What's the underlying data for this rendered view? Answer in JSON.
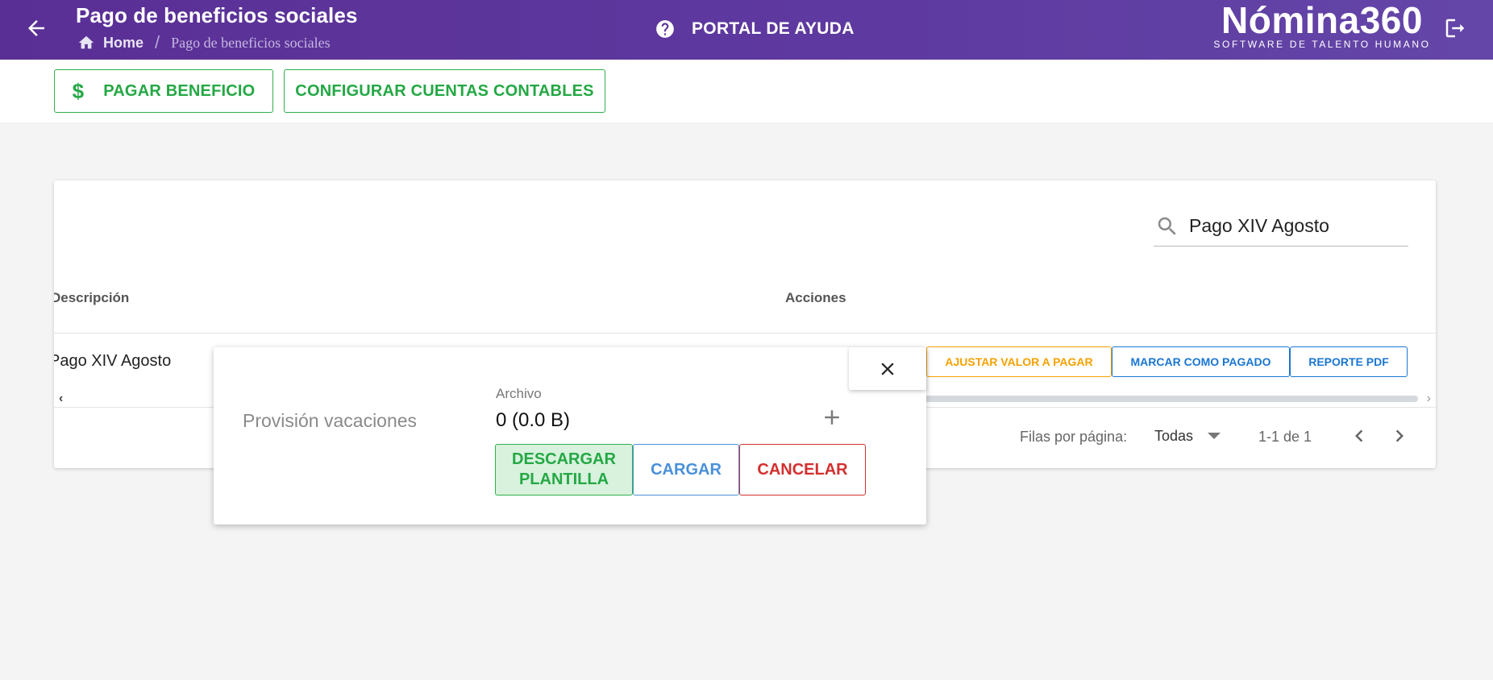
{
  "header": {
    "title": "Pago de beneficios sociales",
    "breadcrumb": {
      "home": "Home",
      "separator": "/",
      "current": "Pago de beneficios sociales"
    },
    "help_label": "PORTAL DE AYUDA",
    "brand_name": "Nómina360",
    "brand_tagline": "SOFTWARE DE TALENTO HUMANO",
    "icons": {
      "back": "arrow-left-icon",
      "home": "home-icon",
      "help": "help-circle-icon",
      "logout": "logout-icon"
    }
  },
  "toolbar": {
    "pay_benefit_icon": "$",
    "pay_benefit_label": "PAGAR BENEFICIO",
    "configure_accounts_label": "CONFIGURAR CUENTAS CONTABLES"
  },
  "table": {
    "search_value": "Pago XIV Agosto",
    "columns": {
      "description": "Descripción",
      "actions": "Acciones"
    },
    "rows": [
      {
        "description": "Pago XIV Agosto",
        "actions": [
          "AJUSTAR VALOR A PAGAR",
          "MARCAR COMO PAGADO",
          "REPORTE PDF"
        ]
      }
    ],
    "pagination": {
      "rows_per_page_label": "Filas por página:",
      "rows_per_page_value": "Todas",
      "range": "1-1 de 1"
    }
  },
  "popup": {
    "label": "Provisión vacaciones",
    "file_label": "Archivo",
    "file_size": "0 (0.0 B)",
    "download_template_line1": "DESCARGAR",
    "download_template_line2": "PLANTILLA",
    "upload_label": "CARGAR",
    "cancel_label": "CANCELAR"
  },
  "colors": {
    "header_bg": "#5a2f95",
    "green": "#24a844",
    "orange": "#f5a100",
    "blue": "#1976d2",
    "light_blue": "#4a90d9",
    "red": "#d32f2f"
  }
}
